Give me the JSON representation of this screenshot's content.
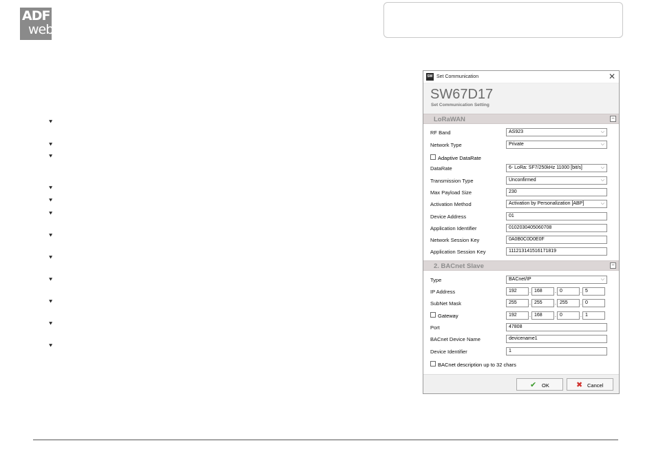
{
  "logo": {
    "line1": "ADF",
    "line2": "web"
  },
  "dialog": {
    "title": "Set Communication",
    "app_icon": "SW",
    "product": "SW67D17",
    "subtitle": "Set Communication Setting",
    "sections": {
      "lorawan": "LoRaWAN",
      "bacnet": "2. BACnet Slave"
    },
    "lorawan": {
      "rf_band_label": "RF Band",
      "rf_band": "AS923",
      "network_type_label": "Network Type",
      "network_type": "Private",
      "adaptive_label": "Adaptive DataRate",
      "datarate_label": "DataRate",
      "datarate": "6- LoRa: SF7/250kHz 11000 [bit/s]",
      "transmission_label": "Transmission Type",
      "transmission": "Unconfirmed",
      "max_payload_label": "Max Payload Size",
      "max_payload": "230",
      "activation_label": "Activation Method",
      "activation": "Activation by Personalization [ABP]",
      "device_address_label": "Device Address",
      "device_address": "01",
      "app_id_label": "Application Identifier",
      "app_id": "0102030405060708",
      "nwk_key_label": "Network Session Key",
      "nwk_key": "0A0B0C0D0E0F",
      "app_key_label": "Application Session Key",
      "app_key": "111213141516171819"
    },
    "bacnet": {
      "type_label": "Type",
      "type": "BACnet/IP",
      "ip_label": "IP Address",
      "ip": [
        "192",
        "168",
        "0",
        "5"
      ],
      "mask_label": "SubNet Mask",
      "mask": [
        "255",
        "255",
        "255",
        "0"
      ],
      "gateway_label": "Gateway",
      "gateway": [
        "192",
        "168",
        "0",
        "1"
      ],
      "port_label": "Port",
      "port": "47808",
      "device_name_label": "BACnet Device Name",
      "device_name": "devicename1",
      "device_id_label": "Device Identifier",
      "device_id": "1",
      "desc_label": "BACnet description up to 32 chars"
    },
    "buttons": {
      "ok": "OK",
      "cancel": "Cancel"
    }
  },
  "icons": {
    "bullet": "arrow-down-bullet-icon",
    "ok": "check-icon",
    "cancel": "cross-icon",
    "close": "close-icon"
  },
  "colors": {
    "section_bg": "#dcd6d6",
    "section_text": "#8d8d8d",
    "ok_check": "#3a9a2a",
    "cancel_cross": "#d0312d"
  }
}
